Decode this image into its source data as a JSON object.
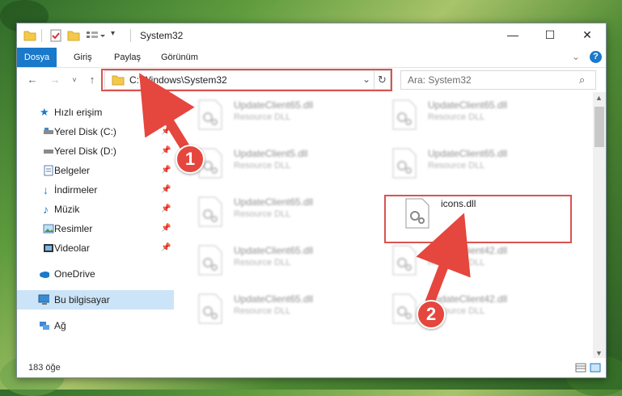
{
  "window": {
    "title": "System32",
    "controls": {
      "minimize": "—",
      "maximize": "☐",
      "close": "✕"
    }
  },
  "ribbon": {
    "tabs": [
      "Dosya",
      "Giriş",
      "Paylaş",
      "Görünüm"
    ],
    "help": "?"
  },
  "address": {
    "path": "C:\\Windows\\System32",
    "search_placeholder": "Ara: System32"
  },
  "nav": {
    "items": [
      {
        "label": "Hızlı erişim",
        "icon": "star-icon"
      },
      {
        "label": "Yerel Disk (C:)",
        "icon": "drive-icon",
        "pinned": true
      },
      {
        "label": "Yerel Disk (D:)",
        "icon": "drive-icon",
        "pinned": true
      },
      {
        "label": "Belgeler",
        "icon": "documents-icon",
        "pinned": true
      },
      {
        "label": "İndirmeler",
        "icon": "downloads-icon",
        "pinned": true
      },
      {
        "label": "Müzik",
        "icon": "music-icon",
        "pinned": true
      },
      {
        "label": "Resimler",
        "icon": "pictures-icon",
        "pinned": true
      },
      {
        "label": "Videolar",
        "icon": "videos-icon",
        "pinned": true
      },
      {
        "label": "OneDrive",
        "icon": "cloud-icon"
      },
      {
        "label": "Bu bilgisayar",
        "icon": "computer-icon",
        "selected": true
      },
      {
        "label": "Ağ",
        "icon": "network-icon"
      }
    ]
  },
  "files": [
    {
      "name": "UpdateClient65.dll",
      "desc": "Resource DLL"
    },
    {
      "name": "UpdateClient65.dll",
      "desc": "Resource DLL"
    },
    {
      "name": "UpdateClient5.dll",
      "desc": "Resource DLL"
    },
    {
      "name": "UpdateClient65.dll",
      "desc": "Resource DLL"
    },
    {
      "name": "UpdateClient65.dll",
      "desc": "Resource DLL"
    },
    {
      "name": "icons.dll",
      "desc": ""
    },
    {
      "name": "UpdateClient65.dll",
      "desc": "Resource DLL"
    },
    {
      "name": "UpdateClient42.dll",
      "desc": "Resource DLL"
    },
    {
      "name": "UpdateClient65.dll",
      "desc": "Resource DLL"
    },
    {
      "name": "UpdateClient42.dll",
      "desc": "Resource DLL"
    }
  ],
  "status": {
    "count": "183 öğe"
  },
  "annotations": {
    "step1": "1",
    "step2": "2",
    "color": "#e5463e"
  }
}
